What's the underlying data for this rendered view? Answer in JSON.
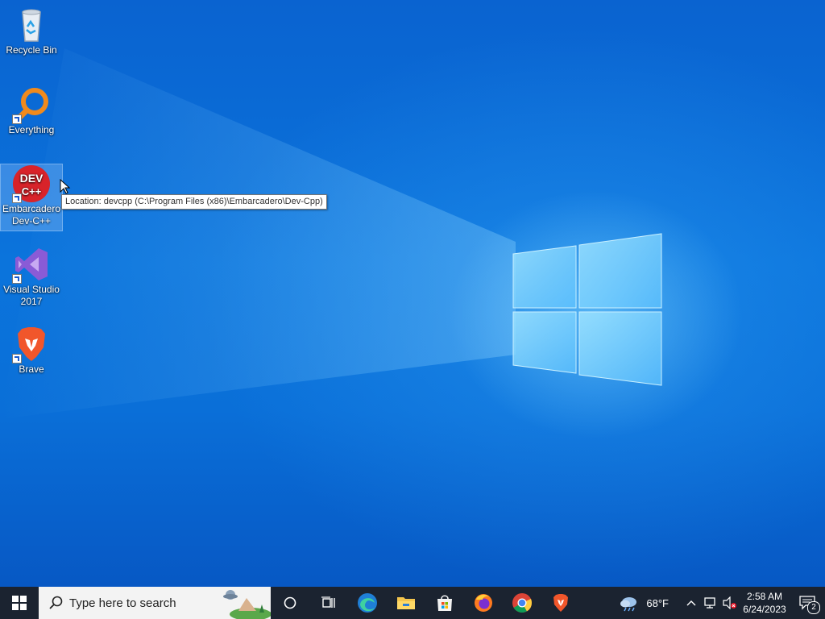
{
  "desktop": {
    "icons": [
      {
        "label": "Recycle Bin",
        "icon": "recycle-bin-icon"
      },
      {
        "label": "Everything",
        "icon": "everything-search-icon"
      },
      {
        "label": "Embarcadero Dev-C++",
        "icon": "devcpp-icon",
        "selected": true
      },
      {
        "label": "Visual Studio 2017",
        "icon": "visual-studio-icon"
      },
      {
        "label": "Brave",
        "icon": "brave-icon"
      }
    ],
    "tooltip": "Location: devcpp (C:\\Program Files (x86)\\Embarcadero\\Dev-Cpp)"
  },
  "taskbar": {
    "search_placeholder": "Type here to search",
    "pinned": [
      "cortana-icon",
      "task-view-icon",
      "edge-icon",
      "file-explorer-icon",
      "microsoft-store-icon",
      "firefox-icon",
      "chrome-icon",
      "brave-icon"
    ],
    "weather_temp": "68°F",
    "clock_time": "2:58 AM",
    "clock_date": "6/24/2023",
    "notification_count": "2"
  },
  "colors": {
    "taskbar_bg": "#1b2330",
    "desktop_blue": "#0a6fd8",
    "selection": "#aad2ff"
  }
}
